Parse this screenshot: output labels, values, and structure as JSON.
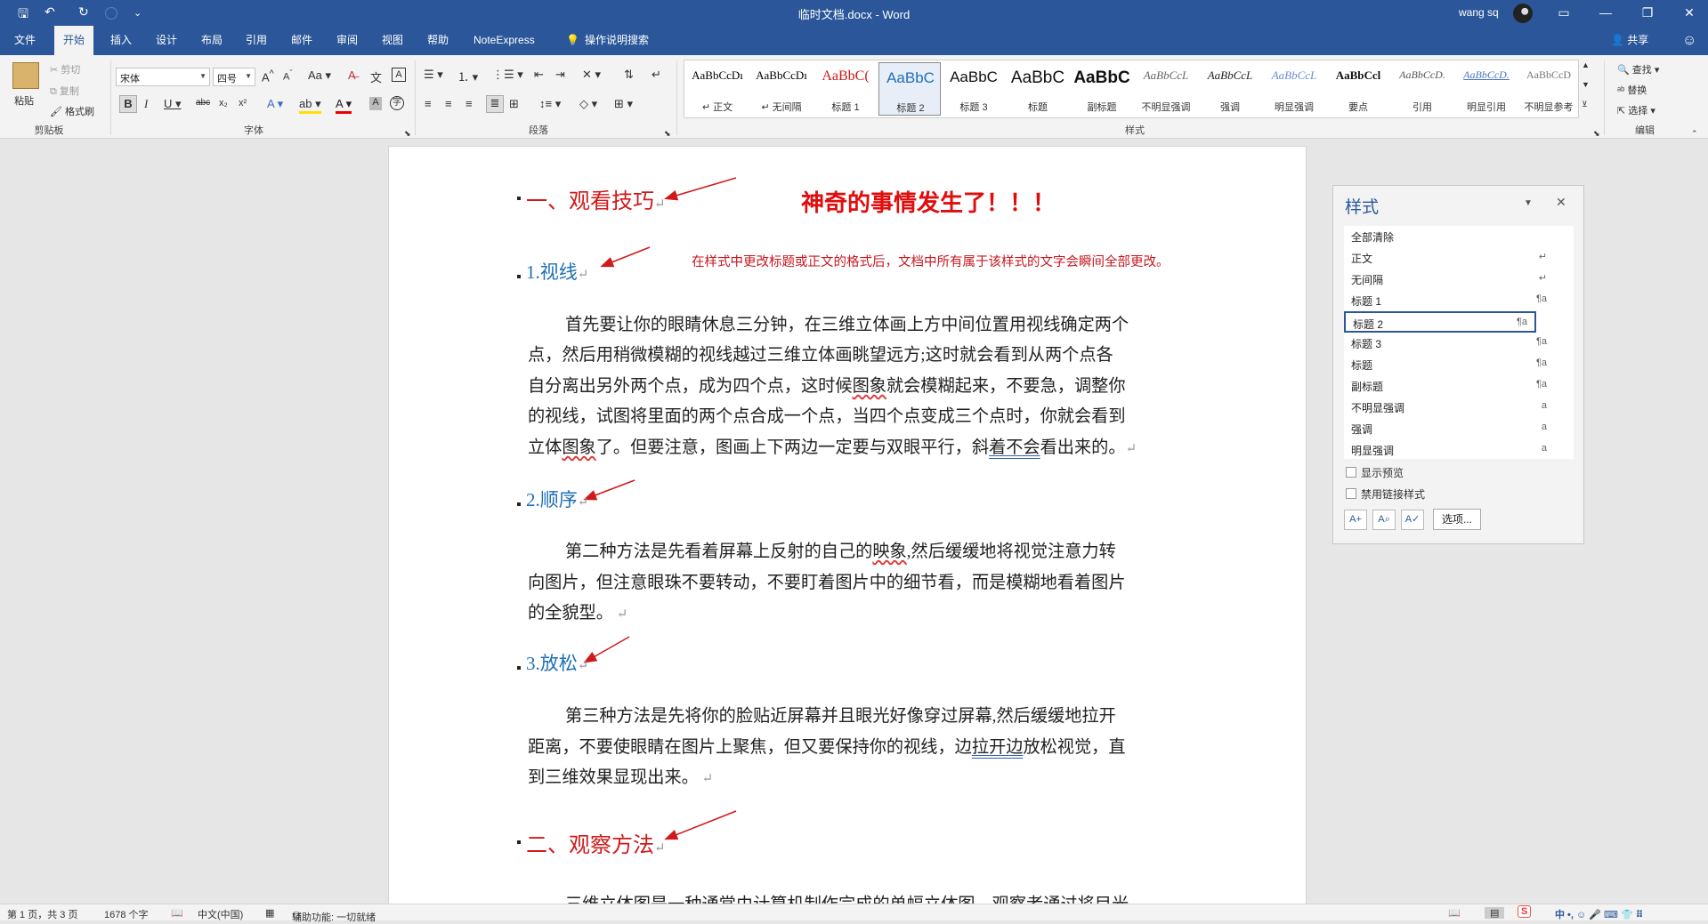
{
  "titlebar": {
    "title": "临时文档.docx  -  Word",
    "user": "wang sq",
    "qa_save": "🖫",
    "qa_undo": "↶",
    "qa_redo": "↻",
    "qa_more": "⌄",
    "win_ribbon_opts": "▭",
    "win_min": "—",
    "win_max": "❐",
    "win_close": "✕"
  },
  "tabs": [
    {
      "label": "文件"
    },
    {
      "label": "开始"
    },
    {
      "label": "插入"
    },
    {
      "label": "设计"
    },
    {
      "label": "布局"
    },
    {
      "label": "引用"
    },
    {
      "label": "邮件"
    },
    {
      "label": "审阅"
    },
    {
      "label": "视图"
    },
    {
      "label": "帮助"
    },
    {
      "label": "NoteExpress"
    },
    {
      "label": "操作说明搜索"
    }
  ],
  "share_label": "共享",
  "ribbon": {
    "clipboard": {
      "paste": "粘贴",
      "cut": "剪切",
      "copy": "复制",
      "format_painter": "格式刷",
      "group": "剪贴板"
    },
    "font": {
      "font_name": "宋体",
      "font_size": "四号",
      "group": "字体"
    },
    "paragraph": {
      "group": "段落"
    },
    "styles": {
      "group": "样式",
      "items": [
        {
          "sample": "AaBbCcDı",
          "name": "↵ 正文"
        },
        {
          "sample": "AaBbCcDı",
          "name": "↵ 无间隔"
        },
        {
          "sample": "AaBbC(",
          "name": "标题 1"
        },
        {
          "sample": "AaBbC",
          "name": "标题 2"
        },
        {
          "sample": "AaBbC",
          "name": "标题 3"
        },
        {
          "sample": "AaBbC",
          "name": "标题"
        },
        {
          "sample": "AaBbC",
          "name": "副标题"
        },
        {
          "sample": "AaBbCcL",
          "name": "不明显强调"
        },
        {
          "sample": "AaBbCcL",
          "name": "强调"
        },
        {
          "sample": "AaBbCcL",
          "name": "明显强调"
        },
        {
          "sample": "AaBbCcl",
          "name": "要点"
        },
        {
          "sample": "AaBbCcD.",
          "name": "引用"
        },
        {
          "sample": "AaBbCcD.",
          "name": "明显引用"
        },
        {
          "sample": "AaBbCcD",
          "name": "不明显参考"
        }
      ]
    },
    "editing": {
      "find": "查找",
      "replace": "替换",
      "select": "选择",
      "group": "编辑"
    }
  },
  "document": {
    "h1_a": "一、观看技巧",
    "magic": "神奇的事情发生了！！！",
    "note": "在样式中更改标题或正文的格式后，文档中所有属于该样式的文字会瞬间全部更改。",
    "h2_1": "1.视线",
    "p1": [
      "首先要让你的眼睛休息三分钟，在三维立体画上方中间位置用视线确定两个",
      "点，然后用稍微模糊的视线越过三维立体画眺望远方;这时就会看到从两个点各",
      "自分离出另外两个点，成为四个点，这时候",
      "图象",
      "就会模糊起来，不要急，调整你",
      "的视线，试图将里面的两个点合成一个点，当四个点变成三个点时，你就会看到",
      "立体",
      "图象",
      "了。但要注意，图画上下两边一定要与双眼平行，斜",
      "着不会",
      "看出来的。"
    ],
    "h2_2": "2.顺序",
    "p2": [
      "第二种方法是先看着屏幕上反射的自己的",
      "映象",
      ",然后缓缓地将视觉注意力转",
      "向图片，但注意眼珠不要转动，不要盯着图片中的细节看，而是模糊地看着图片",
      "的全貌型。"
    ],
    "h2_3": "3.放松",
    "p3": [
      "第三种方法是先将你的脸贴近屏幕并且眼光好像穿过屏幕,然后缓缓地拉开",
      "距离，不要使眼睛在图片上聚焦，但又要保持你的视线，边",
      "拉开边",
      "放松视觉，直",
      "到三维效果显现出来。"
    ],
    "h1_b": "二、观察方法",
    "p4_partial": "三维立体图是一种通常由计算机制作完成的单幅立体图，观察者通过将目光"
  },
  "styles_pane": {
    "title": "样式",
    "items": [
      {
        "name": "全部清除",
        "mark": ""
      },
      {
        "name": "正文",
        "mark": "↵"
      },
      {
        "name": "无间隔",
        "mark": "↵"
      },
      {
        "name": "标题 1",
        "mark": "¶a"
      },
      {
        "name": "标题 2",
        "mark": "¶a"
      },
      {
        "name": "标题 3",
        "mark": "¶a"
      },
      {
        "name": "标题",
        "mark": "¶a"
      },
      {
        "name": "副标题",
        "mark": "¶a"
      },
      {
        "name": "不明显强调",
        "mark": "a"
      },
      {
        "name": "强调",
        "mark": "a"
      },
      {
        "name": "明显强调",
        "mark": "a"
      }
    ],
    "show_preview": "显示预览",
    "disable_linked": "禁用链接样式",
    "options": "选项..."
  },
  "statusbar": {
    "page": "第 1 页，共 3 页",
    "words": "1678 个字",
    "lang": "中文(中国)",
    "accessibility": "辅助功能: 一切就绪",
    "ime": "中 •, ☺ 🎤 ⌨ 👕 ⠿"
  },
  "colors": {
    "accent": "#2b579a",
    "heading1": "#d0191a",
    "heading2": "#1f6fb5",
    "annotation": "#e00d0d"
  }
}
